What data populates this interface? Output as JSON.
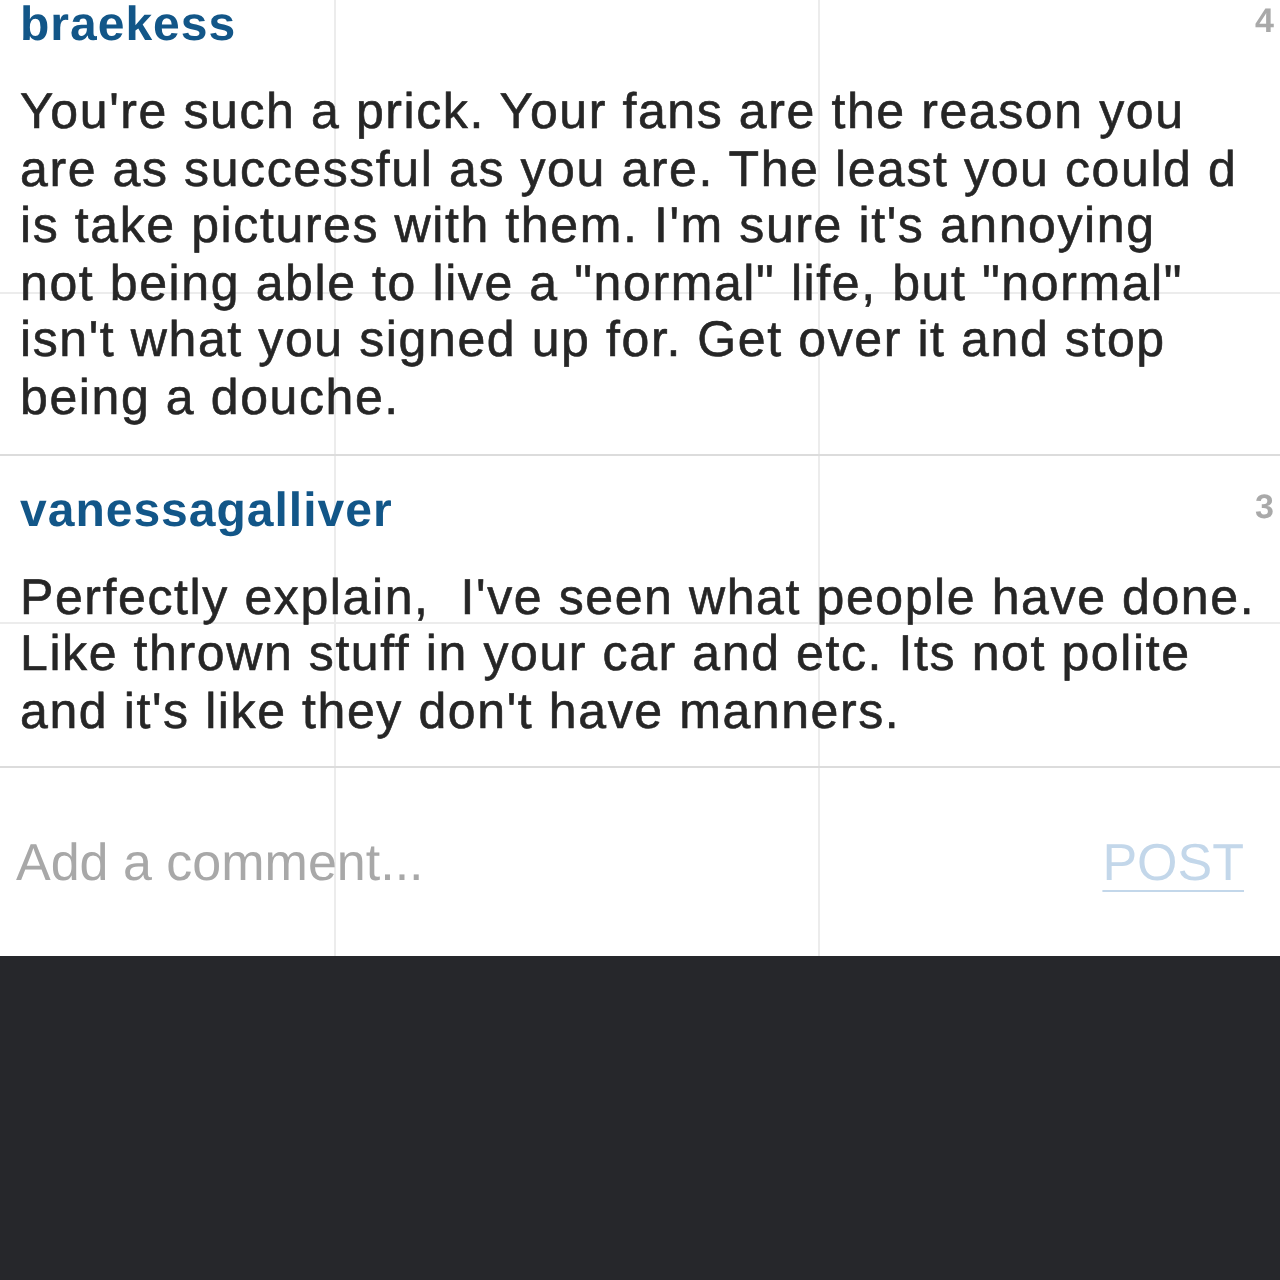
{
  "comments": [
    {
      "username": "braekess",
      "time": "4",
      "text": "You're such a prick. Your fans are the reason you\nare as successful as you are. The least you could d\nis take pictures with them. I'm sure it's annoying\nnot being able to live a \"normal\" life, but \"normal\"\nisn't what you signed up for. Get over it and stop\nbeing a douche."
    },
    {
      "username": "vanessagalliver",
      "time": "3",
      "text": "Perfectly explain,  I've seen what people have done.\nLike thrown stuff in your car and etc. Its not polite\nand it's like they don't have manners."
    }
  ],
  "comment_box": {
    "placeholder": "Add a comment...",
    "button": {
      "label": "POST",
      "disabled": true
    }
  }
}
